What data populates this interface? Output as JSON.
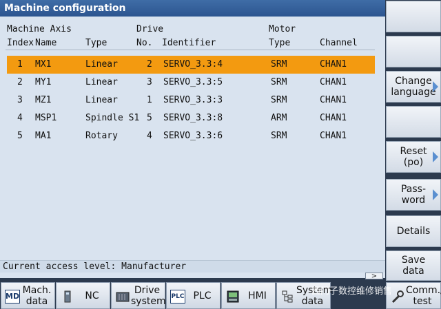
{
  "window": {
    "title": "Machine configuration"
  },
  "headers": {
    "group_machine_axis": "Machine Axis",
    "group_drive": "Drive",
    "group_motor": "Motor",
    "index": "Index",
    "name": "Name",
    "type": "Type",
    "drive_no": "No.",
    "identifier": "Identifier",
    "motor_type": "Type",
    "channel": "Channel"
  },
  "rows": [
    {
      "index": "1",
      "name": "MX1",
      "type": "Linear",
      "drive_no": "2",
      "identifier": "SERVO_3.3:4",
      "motor_type": "SRM",
      "channel": "CHAN1"
    },
    {
      "index": "2",
      "name": "MY1",
      "type": "Linear",
      "drive_no": "3",
      "identifier": "SERVO_3.3:5",
      "motor_type": "SRM",
      "channel": "CHAN1"
    },
    {
      "index": "3",
      "name": "MZ1",
      "type": "Linear",
      "drive_no": "1",
      "identifier": "SERVO_3.3:3",
      "motor_type": "SRM",
      "channel": "CHAN1"
    },
    {
      "index": "4",
      "name": "MSP1",
      "type": "Spindle S1",
      "drive_no": "5",
      "identifier": "SERVO_3.3:8",
      "motor_type": "ARM",
      "channel": "CHAN1"
    },
    {
      "index": "5",
      "name": "MA1",
      "type": "Rotary",
      "drive_no": "4",
      "identifier": "SERVO_3.3:6",
      "motor_type": "SRM",
      "channel": "CHAN1"
    }
  ],
  "selected_row_index": 0,
  "status": {
    "access_level": "Current access level: Manufacturer",
    "scroll_right": ">"
  },
  "vertical_softkeys": {
    "k1": "",
    "k2": "",
    "k3_line1": "Change",
    "k3_line2": "language",
    "k4": "",
    "k5_line1": "Reset",
    "k5_line2": "(po)",
    "k6_line1": "Pass-",
    "k6_line2": "word",
    "k7": "Details",
    "k8_line1": "Save",
    "k8_line2": "data"
  },
  "horizontal_softkeys": {
    "mach_line1": "Mach.",
    "mach_line2": "data",
    "mach_icon_text": "MD",
    "nc": "NC",
    "drive_line1": "Drive",
    "drive_line2": "system",
    "plc": "PLC",
    "plc_icon_text": "PLC",
    "hmi": "HMI",
    "sys_line1": "System",
    "sys_line2": "data",
    "comm_line1": "Comm./",
    "comm_line2": "test"
  },
  "watermark": "西门子数控维修销售",
  "colors": {
    "selection": "#f39a10",
    "title_bar": "#2c5590",
    "panel_bg": "#d9e3ef",
    "arrow": "#5a8fd0"
  }
}
